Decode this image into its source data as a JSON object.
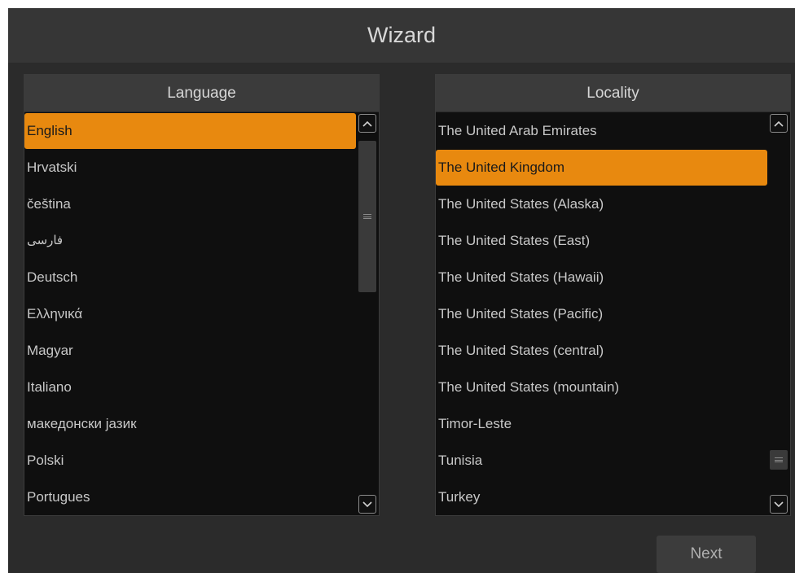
{
  "window": {
    "title": "Wizard"
  },
  "language": {
    "header": "Language",
    "items": [
      "English",
      "Hrvatski",
      "čeština",
      "فارسی",
      "Deutsch",
      "Ελληνικά",
      "Magyar",
      "Italiano",
      "македонски јазик",
      "Polski",
      "Portugues"
    ],
    "selected": "English"
  },
  "locality": {
    "header": "Locality",
    "items": [
      "The United Arab Emirates",
      "The United Kingdom",
      "The United States (Alaska)",
      "The United States (East)",
      "The United States (Hawaii)",
      "The United States (Pacific)",
      "The United States (central)",
      "The United States (mountain)",
      "Timor-Leste",
      "Tunisia",
      "Turkey"
    ],
    "selected": "The United Kingdom"
  },
  "footer": {
    "next_label": "Next"
  },
  "colors": {
    "accent": "#e8890f",
    "background": "#2b2b2b",
    "list_background": "#0f0f0f",
    "header_background": "#3b3b3b"
  },
  "icons": {
    "scroll_up": "chevron-up-icon",
    "scroll_down": "chevron-down-icon",
    "thumb_grip": "grip-icon"
  }
}
